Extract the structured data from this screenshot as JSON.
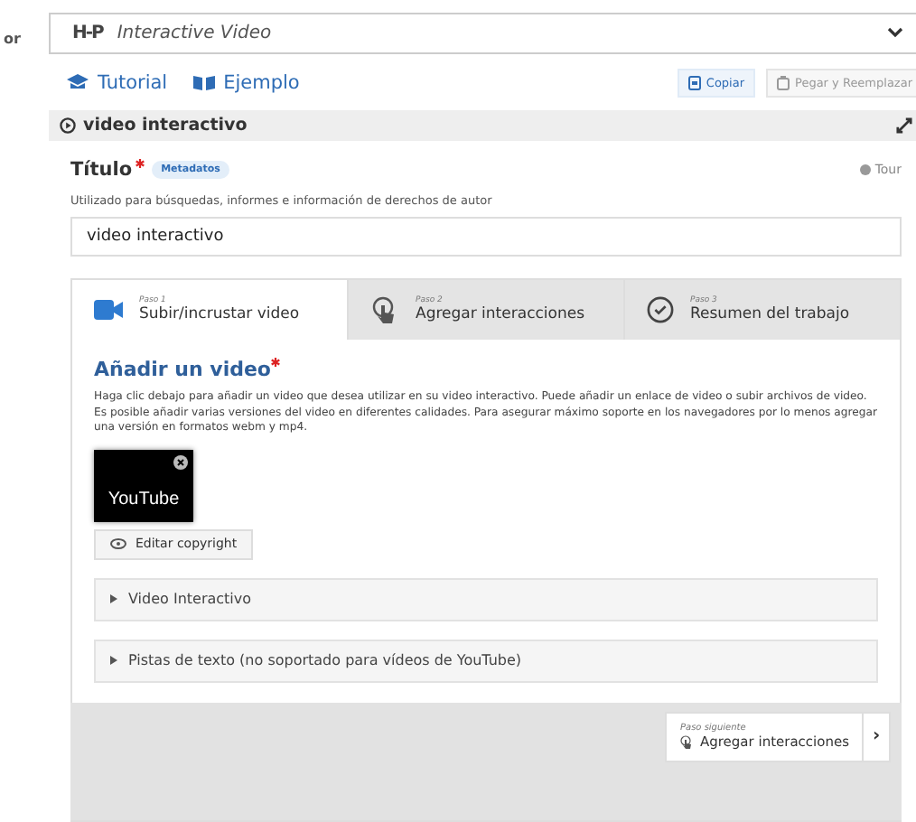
{
  "side_label": "or",
  "content_type": {
    "logo": "H-P",
    "title": "Interactive Video"
  },
  "links": [
    {
      "kind": "tutorial",
      "label": "Tutorial"
    },
    {
      "kind": "example",
      "label": "Ejemplo"
    }
  ],
  "clipboard": [
    {
      "kind": "copy",
      "label": "Copiar",
      "disabled": false
    },
    {
      "kind": "paste",
      "label": "Pegar y Reemplazar",
      "disabled": true
    }
  ],
  "section": {
    "title": "video interactivo"
  },
  "title_field": {
    "label": "Título",
    "required": true,
    "badge": "Metadatos",
    "tour": "Tour",
    "description": "Utilizado para búsquedas, informes e información de derechos de autor",
    "value": "video interactivo"
  },
  "steps": [
    {
      "kind": "video",
      "step": "Paso 1",
      "label": "Subir/incrustar video",
      "selected": true
    },
    {
      "kind": "interactions",
      "step": "Paso 2",
      "label": "Agregar interacciones",
      "selected": false
    },
    {
      "kind": "summary",
      "step": "Paso 3",
      "label": "Resumen del trabajo",
      "selected": false
    }
  ],
  "video": {
    "heading": "Añadir un video",
    "required": true,
    "description": "Haga clic debajo para añadir un video que desea utilizar en su video interactivo. Puede añadir un enlace de video o subir archivos de video. Es posible añadir varias versiones del video en diferentes calidades. Para asegurar máximo soporte en los navegadores por lo menos agregar una versión en formatos webm y mp4.",
    "thumbnail": "YouTube",
    "copyright_button": "Editar copyright"
  },
  "accordions": [
    {
      "label": "Video Interactivo",
      "expanded": false
    },
    {
      "label": "Pistas de texto (no soportado para vídeos de YouTube)",
      "expanded": false
    }
  ],
  "next_step": {
    "caption": "Paso siguiente",
    "label": "Agregar interacciones",
    "arrow": "›"
  }
}
